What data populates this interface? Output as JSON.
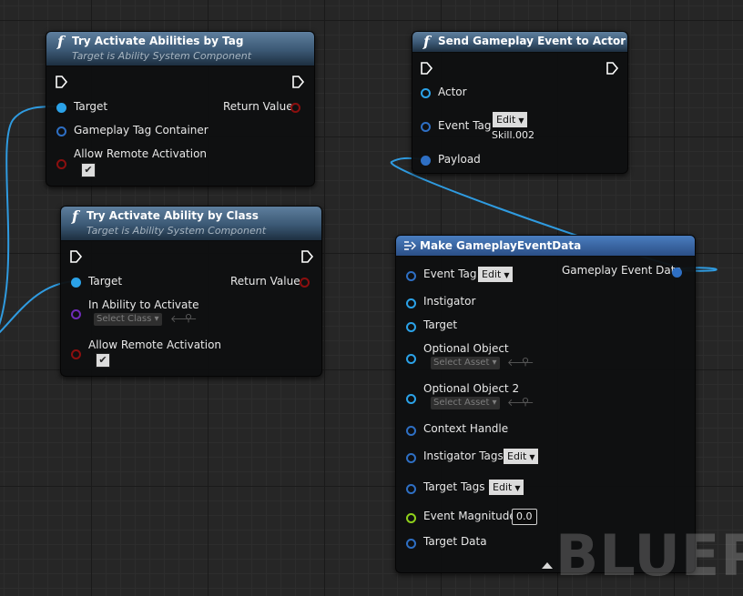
{
  "watermark": "BLUEPR",
  "node_tag": {
    "title": "Try Activate Abilities by Tag",
    "subtitle": "Target is Ability System Component",
    "pins": {
      "target": "Target",
      "tag_container": "Gameplay Tag Container",
      "allow_remote": "Allow Remote Activation",
      "return_value": "Return Value"
    },
    "allow_remote_checked": true
  },
  "node_class": {
    "title": "Try Activate Ability by Class",
    "subtitle": "Target is Ability System Component",
    "pins": {
      "target": "Target",
      "ability": "In Ability to Activate",
      "allow_remote": "Allow Remote Activation",
      "return_value": "Return Value"
    },
    "select_class": "Select Class",
    "allow_remote_checked": true
  },
  "node_send": {
    "title": "Send Gameplay Event to Actor",
    "pins": {
      "actor": "Actor",
      "event_tag": "Event Tag",
      "payload": "Payload"
    },
    "edit_label": "Edit",
    "event_tag_value": "Skill.002"
  },
  "node_make": {
    "title": "Make GameplayEventData",
    "pins": {
      "event_tag": "Event Tag",
      "instigator": "Instigator",
      "target": "Target",
      "optional_object": "Optional Object",
      "optional_object_2": "Optional Object 2",
      "context_handle": "Context Handle",
      "instigator_tags": "Instigator Tags",
      "target_tags": "Target Tags",
      "event_magnitude": "Event Magnitude",
      "target_data": "Target Data",
      "output": "Gameplay Event Data"
    },
    "edit_label": "Edit",
    "select_asset": "Select Asset",
    "event_magnitude_value": "0.0"
  }
}
